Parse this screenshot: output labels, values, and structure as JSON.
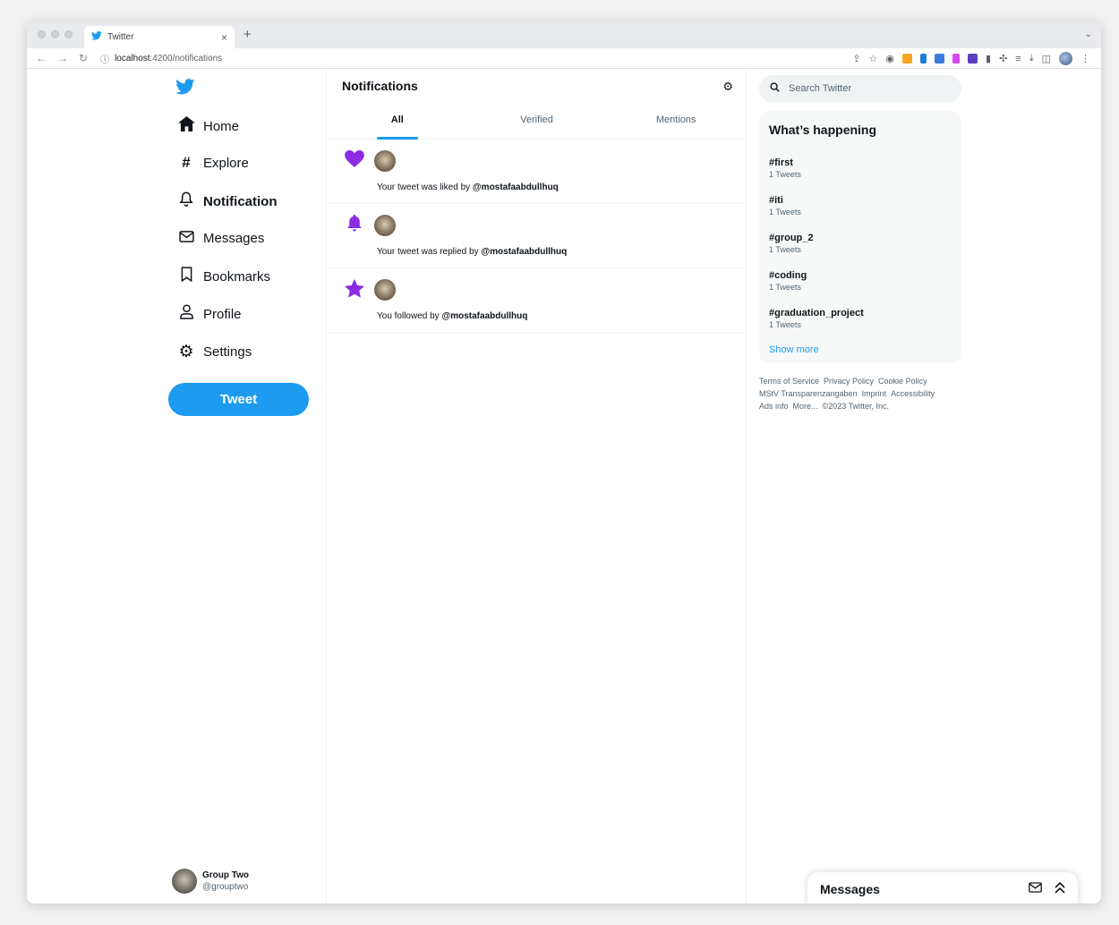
{
  "browser": {
    "tab_title": "Twitter",
    "tab_close": "×",
    "new_tab": "+",
    "tab_menu": "⌄",
    "url_host": "localhost",
    "url_path": ":4200/notifications"
  },
  "sidebar": {
    "items": [
      {
        "label": "Home",
        "icon": "⌂"
      },
      {
        "label": "Explore",
        "icon": "#"
      },
      {
        "label": "Notification",
        "icon": "🔔︎"
      },
      {
        "label": "Messages",
        "icon": "✉"
      },
      {
        "label": "Bookmarks",
        "icon": "❏"
      },
      {
        "label": "Profile",
        "icon": "♙"
      },
      {
        "label": "Settings",
        "icon": "⚙"
      }
    ],
    "tweet_button": "Tweet",
    "account_name": "Group Two",
    "account_handle": "@grouptwo"
  },
  "main": {
    "title": "Notifications",
    "tabs": [
      "All",
      "Verified",
      "Mentions"
    ],
    "notifications": [
      {
        "type_icon": "heart",
        "text": "Your tweet was liked by ",
        "user": "@mostafaabdullhuq"
      },
      {
        "type_icon": "bell",
        "text": "Your tweet was replied by ",
        "user": "@mostafaabdullhuq"
      },
      {
        "type_icon": "star",
        "text": "You followed by ",
        "user": "@mostafaabdullhuq"
      }
    ]
  },
  "right": {
    "search_placeholder": "Search Twitter",
    "trends_title": "What’s happening",
    "trends": [
      {
        "name": "#first",
        "count": "1 Tweets"
      },
      {
        "name": "#iti",
        "count": "1 Tweets"
      },
      {
        "name": "#group_2",
        "count": "1 Tweets"
      },
      {
        "name": "#coding",
        "count": "1 Tweets"
      },
      {
        "name": "#graduation_project",
        "count": "1 Tweets"
      }
    ],
    "show_more": "Show more",
    "footer": {
      "terms": "Terms of Service",
      "privacy": "Privacy Policy",
      "cookie": "Cookie Policy",
      "mstv": "MStV Transparenzangaben",
      "imprint": "Imprint",
      "accessibility": "Accessibility",
      "ads": "Ads info",
      "more": "More...",
      "copyright": "©2023 Twitter, Inc."
    }
  },
  "messages_drawer": {
    "title": "Messages"
  },
  "colors": {
    "brand": "#1d9bf0",
    "notif_icon": "#8c2be2"
  }
}
